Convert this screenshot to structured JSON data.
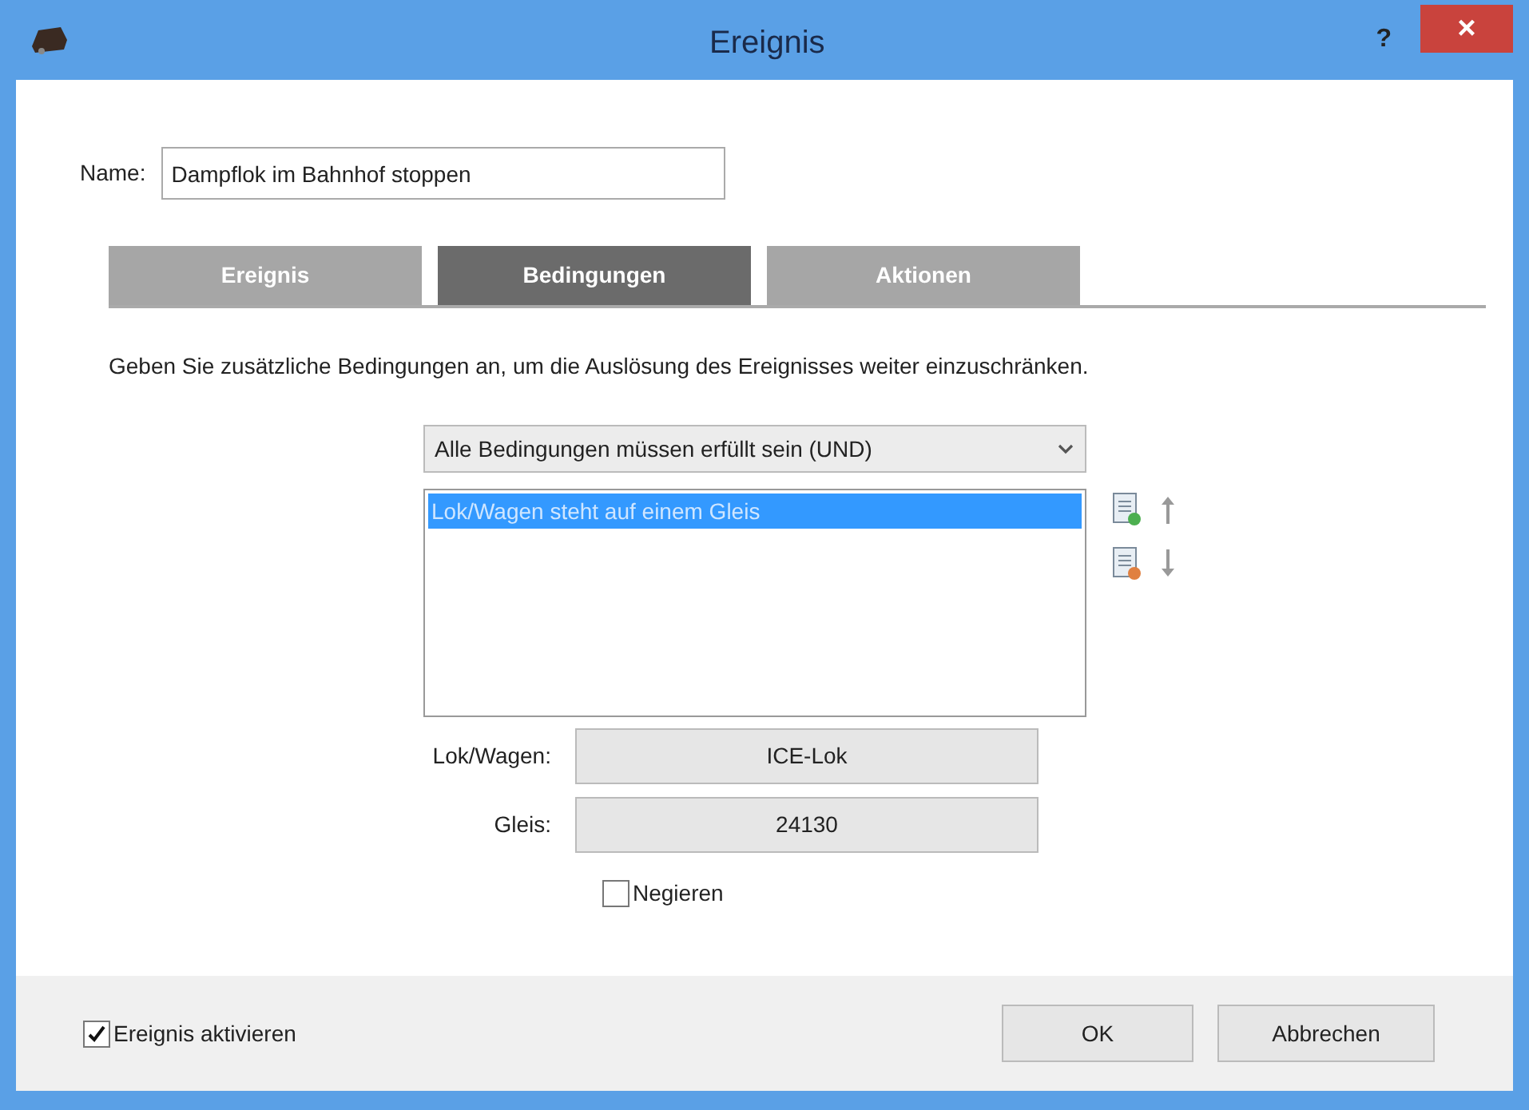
{
  "window": {
    "title": "Ereignis",
    "help": "?",
    "close": "×"
  },
  "name": {
    "label": "Name:",
    "value": "Dampflok im Bahnhof stoppen"
  },
  "tabs": [
    {
      "label": "Ereignis",
      "selected": false
    },
    {
      "label": "Bedingungen",
      "selected": true
    },
    {
      "label": "Aktionen",
      "selected": false
    }
  ],
  "description": "Geben Sie zusätzliche Bedingungen an, um die Auslösung des Ereignisses weiter einzuschränken.",
  "mode_dropdown": {
    "value": "Alle Bedingungen müssen erfüllt sein (UND)"
  },
  "conditions": [
    {
      "label": "Lok/Wagen steht auf einem Gleis",
      "selected": true
    }
  ],
  "fields": [
    {
      "label": "Lok/Wagen:",
      "value": "ICE-Lok"
    },
    {
      "label": "Gleis:",
      "value": "24130"
    }
  ],
  "negate": {
    "label": "Negieren",
    "checked": false
  },
  "activate": {
    "label": "Ereignis aktivieren",
    "checked": true
  },
  "buttons": [
    "OK",
    "Abbrechen"
  ]
}
